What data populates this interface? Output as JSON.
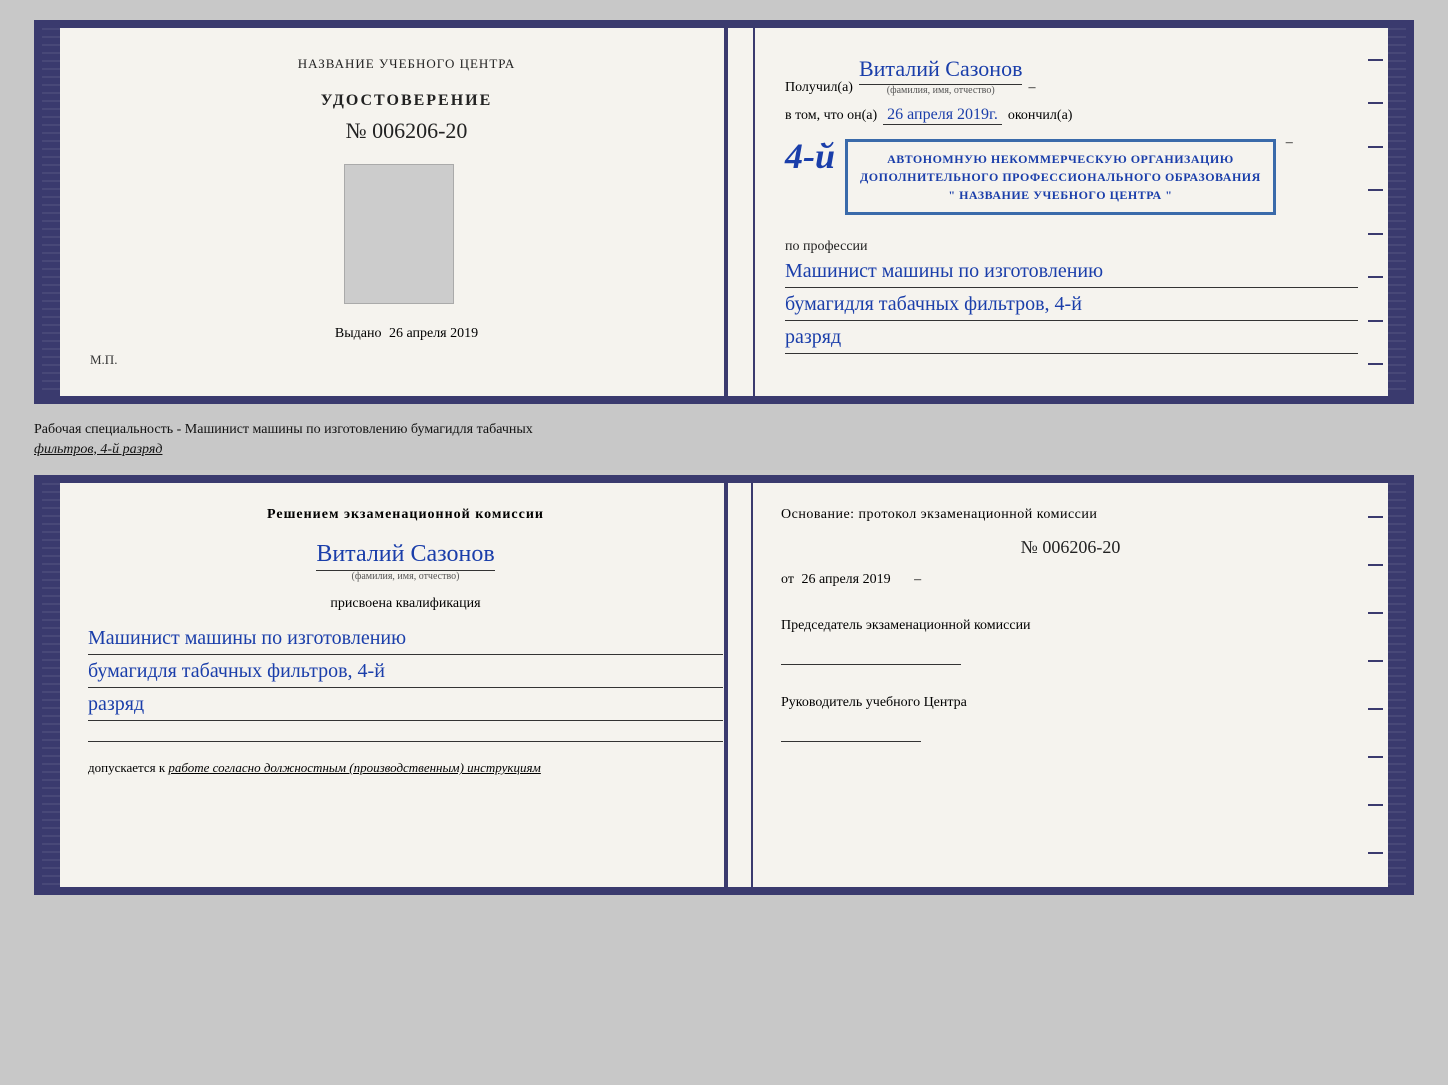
{
  "top_doc": {
    "left": {
      "center_title": "НАЗВАНИЕ УЧЕБНОГО ЦЕНТРА",
      "cert_label": "УДОСТОВЕРЕНИЕ",
      "cert_number": "№ 006206-20",
      "issued_label": "Выдано",
      "issued_date": "26 апреля 2019",
      "mp_label": "М.П."
    },
    "right": {
      "received_prefix": "Получил(а)",
      "recipient_name": "Виталий Сазонов",
      "recipient_sublabel": "(фамилия, имя, отчество)",
      "in_that_prefix": "в том, что он(а)",
      "completion_date": "26 апреля 2019г.",
      "completed_suffix": "окончил(а)",
      "big_number": "4-й",
      "stamp_line1": "АВТОНОМНУЮ НЕКОММЕРЧЕСКУЮ ОРГАНИЗАЦИЮ",
      "stamp_line2": "ДОПОЛНИТЕЛЬНОГО ПРОФЕССИОНАЛЬНОГО ОБРАЗОВАНИЯ",
      "stamp_line3": "\" НАЗВАНИЕ УЧЕБНОГО ЦЕНТРА \"",
      "profession_label": "по профессии",
      "profession_line1": "Машинист машины по изготовлению",
      "profession_line2": "бумагидля табачных фильтров, 4-й",
      "profession_line3": "разряд"
    }
  },
  "between_label": {
    "text1": "Рабочая специальность - Машинист машины по изготовлению бумагидля табачных",
    "text2": "фильтров, 4-й разряд"
  },
  "bottom_doc": {
    "left": {
      "decision_text": "Решением экзаменационной комиссии",
      "person_name": "Виталий Сазонов",
      "person_sublabel": "(фамилия, имя, отчество)",
      "qualification_label": "присвоена квалификация",
      "qualification_line1": "Машинист машины по изготовлению",
      "qualification_line2": "бумагидля табачных фильтров, 4-й",
      "qualification_line3": "разряд",
      "allowed_prefix": "допускается к",
      "allowed_text": "работе согласно должностным (производственным) инструкциям"
    },
    "right": {
      "basis_text": "Основание: протокол экзаменационной комиссии",
      "protocol_number": "№ 006206-20",
      "from_prefix": "от",
      "from_date": "26 апреля 2019",
      "chairman_label": "Председатель экзаменационной комиссии",
      "director_label": "Руководитель учебного Центра"
    }
  }
}
